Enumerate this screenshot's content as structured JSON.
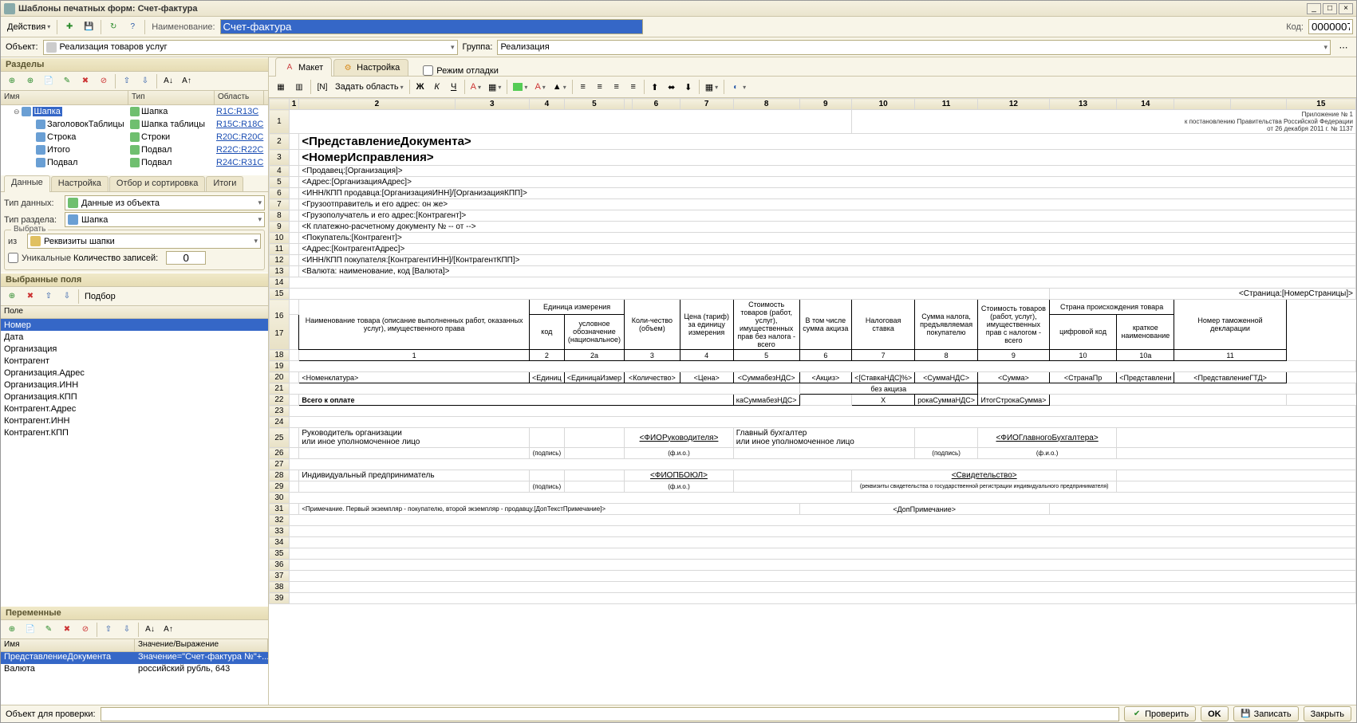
{
  "titlebar": {
    "title": "Шаблоны печатных форм: Счет-фактура"
  },
  "toolbar": {
    "actions": "Действия",
    "name_label": "Наименование:",
    "name_value": "Счет-фактура",
    "code_label": "Код:",
    "code_value": "0000007"
  },
  "objbar": {
    "object_label": "Объект:",
    "object_value": "Реализация товаров услуг",
    "group_label": "Группа:",
    "group_value": "Реализация"
  },
  "sections": {
    "title": "Разделы",
    "h_name": "Имя",
    "h_type": "Тип",
    "h_area": "Область",
    "rows": [
      {
        "name": "Шапка",
        "type": "Шапка",
        "area": "R1C:R13C",
        "sel": true,
        "top": true
      },
      {
        "name": "ЗаголовокТаблицы",
        "type": "Шапка таблицы",
        "area": "R15C:R18C"
      },
      {
        "name": "Строка",
        "type": "Строки",
        "area": "R20C:R20C"
      },
      {
        "name": "Итого",
        "type": "Подвал",
        "area": "R22C:R22C"
      },
      {
        "name": "Подвал",
        "type": "Подвал",
        "area": "R24C:R31C"
      }
    ]
  },
  "datapanel": {
    "tabs": [
      "Данные",
      "Настройка",
      "Отбор и сортировка",
      "Итоги"
    ],
    "type_label": "Тип данных:",
    "type_value": "Данные из объекта",
    "section_label": "Тип раздела:",
    "section_value": "Шапка",
    "choose_legend": "Выбрать",
    "iz_label": "из",
    "iz_value": "Реквизиты шапки",
    "unique": "Уникальные",
    "count_label": "Количество записей:",
    "count_value": "0"
  },
  "fields": {
    "title": "Выбранные поля",
    "podbor": "Подбор",
    "h": "Поле",
    "items": [
      "Номер",
      "Дата",
      "Организация",
      "Контрагент",
      "Организация.Адрес",
      "Организация.ИНН",
      "Организация.КПП",
      "Контрагент.Адрес",
      "Контрагент.ИНН",
      "Контрагент.КПП"
    ]
  },
  "vars": {
    "title": "Переменные",
    "h_name": "Имя",
    "h_val": "Значение/Выражение",
    "rows": [
      {
        "n": "ПредставлениеДокумента",
        "v": "Значение=\"Счет-фактура №\"+...",
        "sel": true
      },
      {
        "n": "Валюта",
        "v": "российский рубль, 643"
      }
    ]
  },
  "editor": {
    "tab_layout": "Макет",
    "tab_settings": "Настройка",
    "debug": "Режим отладки",
    "set_area": "Задать область"
  },
  "doc": {
    "appendix1": "Приложение № 1",
    "appendix2": "к постановлению Правительства Российской Федерации",
    "appendix3": "от 26 декабря 2011 г. № 1137",
    "h1": "<ПредставлениеДокумента>",
    "h2": "<НомерИсправления>",
    "r4": "<Продавец:[Организация]>",
    "r5": "<Адрес:[ОрганизацияАдрес]>",
    "r6": "<ИНН/КПП продавца:[ОрганизацияИНН]/[ОрганизацияКПП]>",
    "r7": "<Грузоотправитель и его адрес: он же>",
    "r8": "<Грузополучатель и его адрес:[Контрагент]>",
    "r9": "<К платежно-расчетному документу № -- от -->",
    "r10": "<Покупатель:[Контрагент]>",
    "r11": "<Адрес:[КонтрагентАдрес]>",
    "r12": "<ИНН/КПП покупателя:[КонтрагентИНН]/[КонтрагентКПП]>",
    "r13": "<Валюта: наименование, код [Валюта]>",
    "page": "<Страница:[НомерСтраницы]>",
    "th": {
      "c1": "Наименование товара (описание выполненных работ, оказанных услуг), имущественного права",
      "c2": "Единица измерения",
      "c2a": "код",
      "c2b": "условное обозначение (национальное)",
      "c3": "Коли-чество (объем)",
      "c4": "Цена (тариф) за единицу измерения",
      "c5": "Стоимость товаров (работ, услуг), имущественных прав без налога - всего",
      "c6": "В том числе сумма акциза",
      "c7": "Налоговая ставка",
      "c8": "Сумма налога, предъявляемая покупателю",
      "c9": "Стоимость товаров (работ, услуг), имущественных прав с налогом - всего",
      "c10": "Страна происхождения товара",
      "c10a": "цифровой код",
      "c10b": "краткое наименование",
      "c11": "Номер таможенной декларации"
    },
    "nums": [
      "1",
      "2",
      "2а",
      "3",
      "4",
      "5",
      "6",
      "7",
      "8",
      "9",
      "10",
      "10а",
      "11"
    ],
    "row": [
      "<Номенклатура>",
      "<Единиц",
      "<ЕдиницаИзмер",
      "<Количество>",
      "<Цена>",
      "<СуммабезНДС>",
      "<Акциз>",
      "<[СтавкаНДС]%>",
      "<СуммаНДС>",
      "<Сумма>",
      "<СтранаПр",
      "<Представлени",
      "<ПредставлениеГТД>"
    ],
    "noakciz": "без акциза",
    "total": "Всего к оплате",
    "tot_vals": [
      "каСуммабезНДС>",
      "X",
      "рокаСуммаНДС>",
      "ИтогСтрокаСумма>"
    ],
    "sig1a": "Руководитель организации",
    "sig1b": "или иное уполномоченное лицо",
    "sig_podpis": "(подпись)",
    "sig_fio": "(ф.и.о.)",
    "fio_ruk": "<ФИОРуководителя>",
    "sig2a": "Главный бухгалтер",
    "sig2b": "или иное уполномоченное лицо",
    "fio_buh": "<ФИОГлавногоБухгалтера>",
    "ip": "Индивидуальный предприниматель",
    "fio_pboyul": "<ФИОПБОЮЛ>",
    "svid": "<Свидетельство>",
    "svid_note": "(реквизиты свидетельства о государственной регистрации индивидуального предпринимателя)",
    "note": "<Примечание. Первый экземпляр - покупателю, второй экземпляр - продавцу.[ДопТекстПримечание]>",
    "dopnote": "<ДопПримечание>"
  },
  "status": {
    "check_label": "Объект для проверки:",
    "verify": "Проверить",
    "ok": "OK",
    "save": "Записать",
    "close": "Закрыть"
  }
}
